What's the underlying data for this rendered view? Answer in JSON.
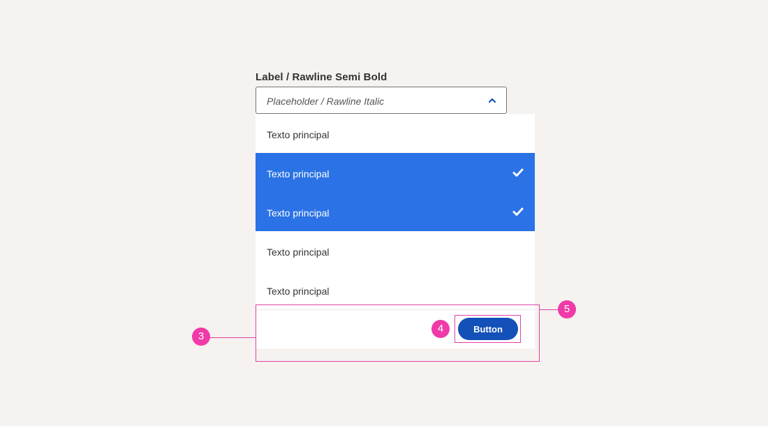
{
  "field": {
    "label": "Label / Rawline Semi Bold",
    "placeholder": "Placeholder / Rawline Italic",
    "expanded": true
  },
  "options": [
    {
      "label": "Texto principal",
      "selected": false
    },
    {
      "label": "Texto principal",
      "selected": true
    },
    {
      "label": "Texto principal",
      "selected": true
    },
    {
      "label": "Texto principal",
      "selected": false
    },
    {
      "label": "Texto principal",
      "selected": false
    }
  ],
  "footer": {
    "button_label": "Button"
  },
  "annotations": {
    "footer_area": "3",
    "button": "4",
    "button_group": "5"
  },
  "colors": {
    "background": "#f5f2ef",
    "selected_option": "#2a72e5",
    "primary_button": "#1350b8",
    "annotation": "#f03aa8",
    "chevron": "#1350b8"
  },
  "icons": {
    "chevron": "chevron-up-icon",
    "selected": "check-icon"
  }
}
